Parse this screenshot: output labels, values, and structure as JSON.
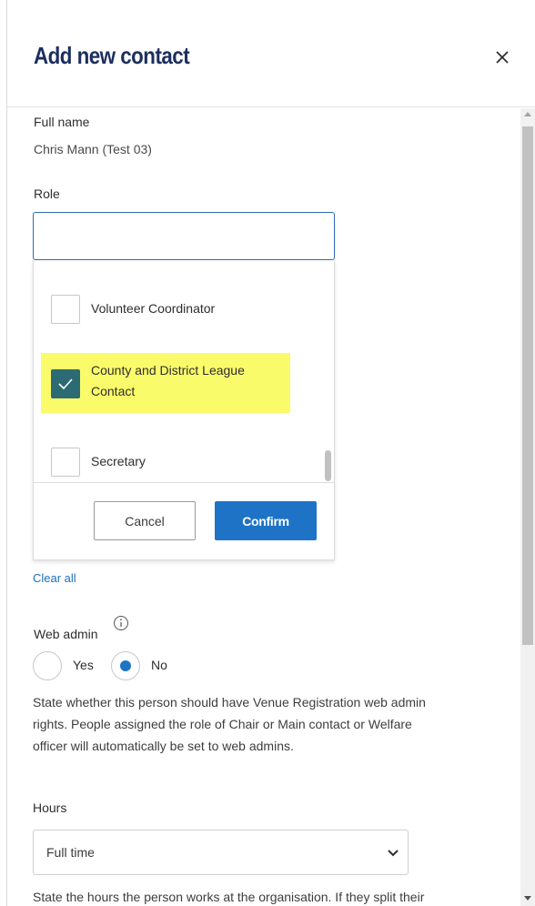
{
  "dialog": {
    "title": "Add new contact",
    "close_icon": "close-icon"
  },
  "full_name": {
    "label": "Full name",
    "value": "Chris Mann (Test 03)"
  },
  "role": {
    "label": "Role",
    "input_value": "",
    "options": [
      {
        "label": "Volunteer Coordinator",
        "checked": false
      },
      {
        "label_line1": "County and District League",
        "label_line2": "Contact",
        "checked": true,
        "highlighted_color": "#fafb6a"
      },
      {
        "label": "Secretary",
        "checked": false
      }
    ],
    "cancel_label": "Cancel",
    "confirm_label": "Confirm",
    "clear_all_label": "Clear all"
  },
  "web_admin": {
    "label": "Web admin",
    "info_icon": "info-icon",
    "options": [
      "Yes",
      "No"
    ],
    "selected": "No",
    "description_lines": [
      "State whether this person should have Venue Registration web admin",
      "rights. People assigned the role of Chair or Main contact or Welfare",
      "officer will automatically be set to web admins."
    ]
  },
  "hours": {
    "label": "Hours",
    "selected": "Full time",
    "description_partial": "State the hours the person works at the organisation. If they split their"
  },
  "colors": {
    "title": "#1c2f5e",
    "primary_button": "#1f73c6",
    "checkbox_checked": "#2d6b74",
    "link": "#1f6fbf"
  }
}
